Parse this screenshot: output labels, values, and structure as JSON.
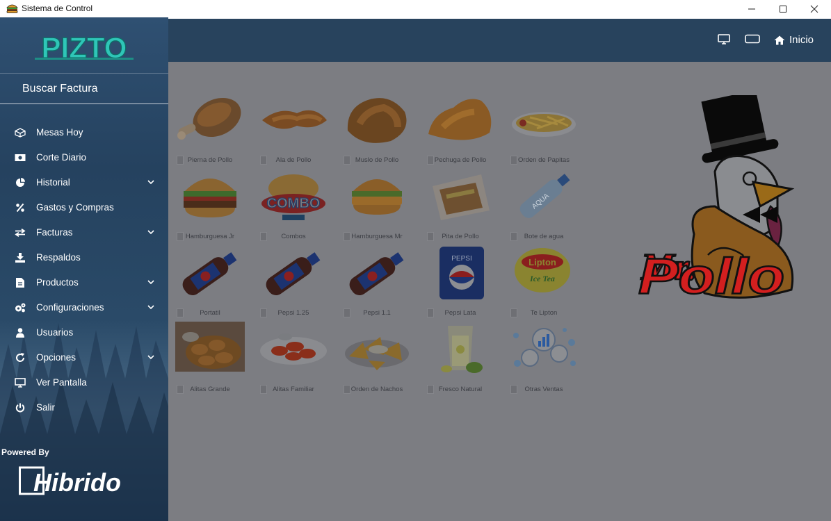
{
  "window": {
    "title": "Sistema de Control"
  },
  "sidebar": {
    "logo_text": "PIZTO",
    "search_label": "Buscar Factura",
    "items": [
      {
        "label": "Mesas Hoy",
        "icon": "cube-icon",
        "has_submenu": false
      },
      {
        "label": "Corte Diario",
        "icon": "money-icon",
        "has_submenu": false
      },
      {
        "label": "Historial",
        "icon": "pie-chart-icon",
        "has_submenu": true
      },
      {
        "label": "Gastos y Compras",
        "icon": "percent-icon",
        "has_submenu": false
      },
      {
        "label": "Facturas",
        "icon": "exchange-icon",
        "has_submenu": true
      },
      {
        "label": "Respaldos",
        "icon": "download-icon",
        "has_submenu": false
      },
      {
        "label": "Productos",
        "icon": "file-icon",
        "has_submenu": true
      },
      {
        "label": "Configuraciones",
        "icon": "cogs-icon",
        "has_submenu": true
      },
      {
        "label": "Usuarios",
        "icon": "user-icon",
        "has_submenu": false
      },
      {
        "label": "Opciones",
        "icon": "refresh-icon",
        "has_submenu": true
      },
      {
        "label": "Ver Pantalla",
        "icon": "monitor-icon",
        "has_submenu": false
      },
      {
        "label": "Salir",
        "icon": "power-icon",
        "has_submenu": false
      }
    ],
    "powered_by": "Powered By",
    "brand": "Hibrido"
  },
  "header": {
    "home_label": "Inicio",
    "icons": [
      "monitor-icon",
      "tablet-icon",
      "home-icon"
    ]
  },
  "products": [
    {
      "name": "Pierna de Pollo",
      "image": "chicken-drumstick"
    },
    {
      "name": "Ala de Pollo",
      "image": "chicken-wing"
    },
    {
      "name": "Muslo de Pollo",
      "image": "chicken-thigh"
    },
    {
      "name": "Pechuga de Pollo",
      "image": "chicken-breast"
    },
    {
      "name": "Orden de Papitas",
      "image": "fries"
    },
    {
      "name": "Hamburguesa Jr",
      "image": "burger"
    },
    {
      "name": "Combos",
      "image": "combo"
    },
    {
      "name": "Hamburguesa Mr",
      "image": "chicken-burger"
    },
    {
      "name": "Pita de Pollo",
      "image": "pita"
    },
    {
      "name": "Bote de agua",
      "image": "water-bottle"
    },
    {
      "name": "Portatil",
      "image": "soda-bottle"
    },
    {
      "name": "Pepsi 1.25",
      "image": "soda-bottle"
    },
    {
      "name": "Pepsi 1.1",
      "image": "soda-bottle"
    },
    {
      "name": "Pepsi Lata",
      "image": "soda-can"
    },
    {
      "name": "Te Lipton",
      "image": "iced-tea"
    },
    {
      "name": "Alitas Grande",
      "image": "wings-basket"
    },
    {
      "name": "Alitas Familiar",
      "image": "wings-plate"
    },
    {
      "name": "Orden de Nachos",
      "image": "nachos"
    },
    {
      "name": "Fresco Natural",
      "image": "lemonade"
    },
    {
      "name": "Otras Ventas",
      "image": "sales-icons"
    }
  ],
  "image_text": {
    "combo": "COMBO",
    "pepsi": "PEPSI",
    "lipton_brand": "Lipton",
    "lipton_product": "Ice Tea",
    "water_brand": "AQUA"
  },
  "mascot": {
    "line1": "Mr.",
    "line2": "Pollo"
  },
  "colors": {
    "sidebar": "#2b4865",
    "header": "#28435d",
    "overlay": "#7c7d82",
    "mascot_red": "#d31f1f"
  }
}
